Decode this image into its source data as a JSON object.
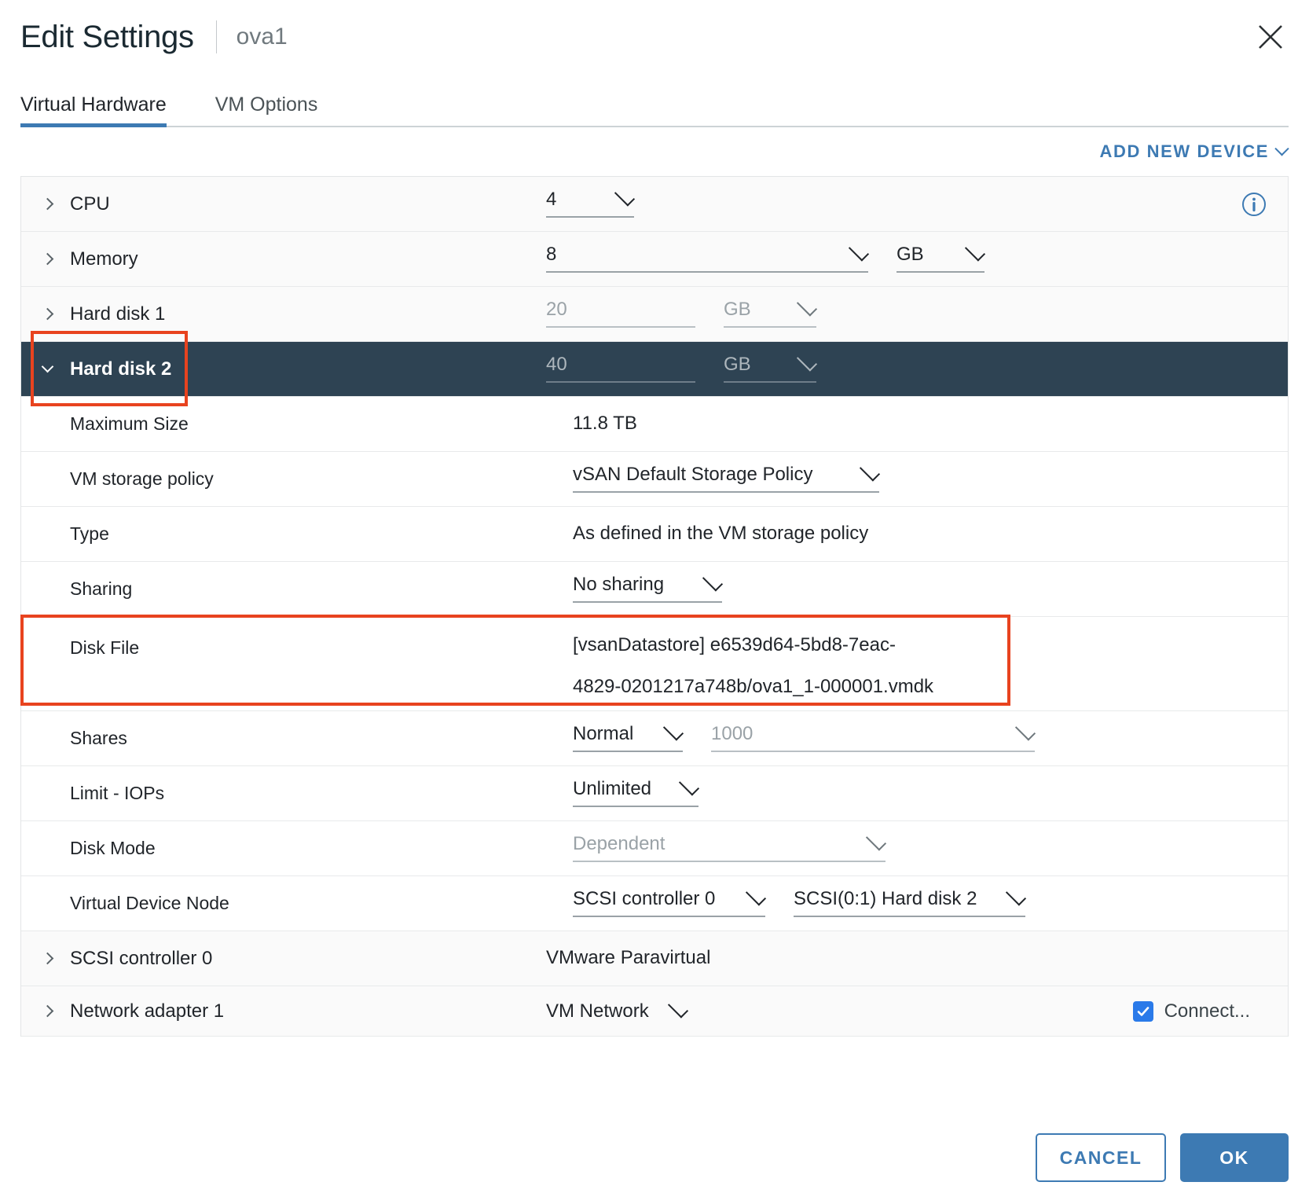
{
  "header": {
    "title": "Edit Settings",
    "vm_name": "ova1",
    "close_icon": "close-icon"
  },
  "tabs": [
    {
      "label": "Virtual Hardware",
      "active": true
    },
    {
      "label": "VM Options",
      "active": false
    }
  ],
  "toolbar": {
    "add_new_device": "ADD NEW DEVICE"
  },
  "rows": {
    "cpu": {
      "label": "CPU",
      "value": "4"
    },
    "memory": {
      "label": "Memory",
      "value": "8",
      "unit": "GB"
    },
    "hard_disk_1": {
      "label": "Hard disk 1",
      "value": "20",
      "unit": "GB"
    },
    "hard_disk_2": {
      "label": "Hard disk 2",
      "value": "40",
      "unit": "GB"
    },
    "maximum_size": {
      "label": "Maximum Size",
      "value": "11.8 TB"
    },
    "vm_storage_policy": {
      "label": "VM storage policy",
      "value": "vSAN Default Storage Policy"
    },
    "type": {
      "label": "Type",
      "value": "As defined in the VM storage policy"
    },
    "sharing": {
      "label": "Sharing",
      "value": "No sharing"
    },
    "disk_file": {
      "label": "Disk File",
      "value_line1": "[vsanDatastore] e6539d64-5bd8-7eac-",
      "value_line2": "4829-0201217a748b/ova1_1-000001.vmdk"
    },
    "shares": {
      "label": "Shares",
      "value": "Normal",
      "amount": "1000"
    },
    "limit_iops": {
      "label": "Limit - IOPs",
      "value": "Unlimited"
    },
    "disk_mode": {
      "label": "Disk Mode",
      "value": "Dependent"
    },
    "virtual_device_node": {
      "label": "Virtual Device Node",
      "controller": "SCSI controller 0",
      "node": "SCSI(0:1) Hard disk 2"
    },
    "scsi_controller_0": {
      "label": "SCSI controller 0",
      "value": "VMware Paravirtual"
    },
    "network_adapter_1": {
      "label": "Network adapter 1",
      "value": "VM Network",
      "connect_label": "Connect..."
    }
  },
  "footer": {
    "cancel": "CANCEL",
    "ok": "OK"
  },
  "colors": {
    "accent": "#3d7ab3",
    "selected_row": "#2e4353",
    "annotation": "#e8431f",
    "checkbox": "#2a7ae9"
  }
}
